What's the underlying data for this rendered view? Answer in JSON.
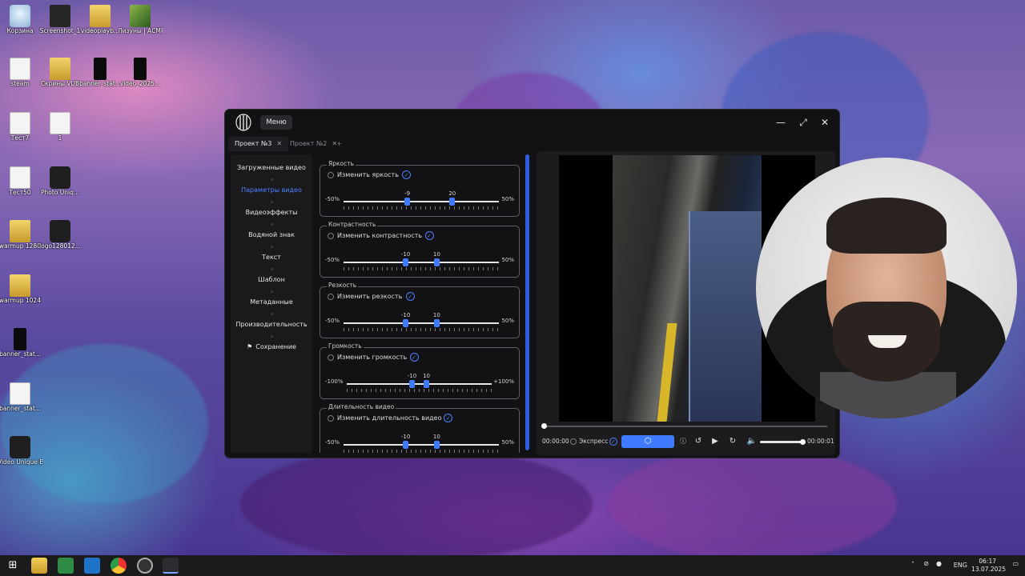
{
  "desktop": {
    "icons": [
      {
        "label": "Корзина",
        "kind": "trash"
      },
      {
        "label": "Screenshot_1",
        "kind": "dark"
      },
      {
        "label": "videoplayb...",
        "kind": "folder"
      },
      {
        "label": "Лизуны | АСМР С/л...",
        "kind": "photo"
      },
      {
        "label": "steam",
        "kind": "file"
      },
      {
        "label": "Скрины VUB",
        "kind": "folder"
      },
      {
        "label": "banner_stat...",
        "kind": "black"
      },
      {
        "label": "video_2025...",
        "kind": "black"
      },
      {
        "label": "Тест7",
        "kind": "file"
      },
      {
        "label": "1",
        "kind": "file"
      },
      {
        "label": "Тест50",
        "kind": "file"
      },
      {
        "label": "Photo Uniq...",
        "kind": "logo"
      },
      {
        "label": "warmup 1280",
        "kind": "folder"
      },
      {
        "label": "logo128012...",
        "kind": "logo"
      },
      {
        "label": "warmup 1024",
        "kind": "folder"
      },
      {
        "label": "banner_stat...",
        "kind": "black"
      },
      {
        "label": "banner_stat...",
        "kind": "file"
      },
      {
        "label": "Video Unique Booster",
        "kind": "logo"
      }
    ]
  },
  "app": {
    "menu_label": "Меню",
    "window_buttons": {
      "minimize": "—",
      "maximize": "⤢",
      "close": "✕"
    },
    "tabs": [
      {
        "label": "Проект №3",
        "active": true
      },
      {
        "label": "Проект №2",
        "active": false
      }
    ],
    "add_tab": "+",
    "sidebar": [
      {
        "label": "Загруженные видео",
        "active": false
      },
      {
        "label": "Параметры видео",
        "active": true
      },
      {
        "label": "Видеоэффекты",
        "active": false
      },
      {
        "label": "Водяной знак",
        "active": false
      },
      {
        "label": "Текст",
        "active": false
      },
      {
        "label": "Шаблон",
        "active": false
      },
      {
        "label": "Метаданные",
        "active": false
      },
      {
        "label": "Производительность",
        "active": false
      },
      {
        "label": "Сохранение",
        "active": false
      }
    ],
    "save_icon_char": "⚑",
    "params": [
      {
        "title": "Яркость",
        "checkbox": "Изменить яркость",
        "min_label": "-50%",
        "max_label": "50%",
        "range": [
          -50,
          50
        ],
        "low": -9,
        "high": 20
      },
      {
        "title": "Контрастность",
        "checkbox": "Изменить контрастность",
        "min_label": "-50%",
        "max_label": "50%",
        "range": [
          -50,
          50
        ],
        "low": -10,
        "high": 10
      },
      {
        "title": "Резкость",
        "checkbox": "Изменить резкость",
        "min_label": "-50%",
        "max_label": "50%",
        "range": [
          -50,
          50
        ],
        "low": -10,
        "high": 10
      },
      {
        "title": "Громкость",
        "checkbox": "Изменить громкость",
        "min_label": "-100%",
        "max_label": "+100%",
        "range": [
          -100,
          100
        ],
        "low": -10,
        "high": 10
      },
      {
        "title": "Длительность видео",
        "checkbox": "Изменить длительность видео",
        "min_label": "-50%",
        "max_label": "50%",
        "range": [
          -50,
          50
        ],
        "low": -10,
        "high": 10
      }
    ],
    "player": {
      "time_start": "00:00:00",
      "time_end": "00:00:01",
      "express_label": "Экспресс",
      "progress": 0.0,
      "volume": 1.0
    }
  },
  "taskbar": {
    "language": "ENG",
    "time": "06:17",
    "date": "13.07.2025"
  },
  "colors": {
    "accent": "#3f7bff",
    "window_bg": "#121214",
    "taskbar_bg": "#1b1b1d"
  }
}
